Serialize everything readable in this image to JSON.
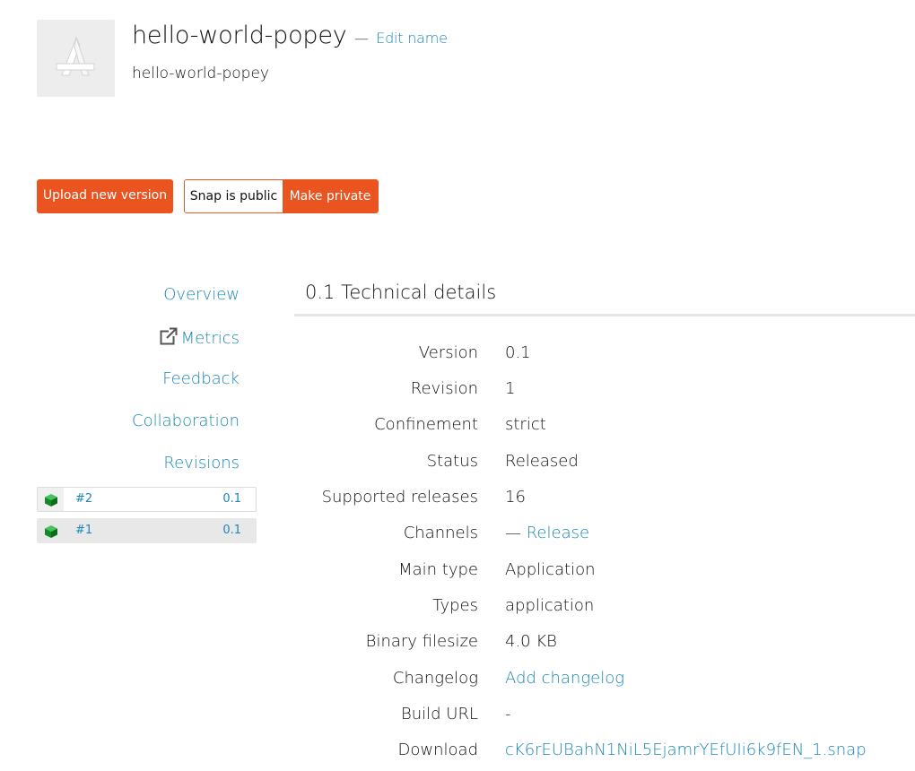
{
  "header": {
    "title": "hello-world-popey",
    "separator": "—",
    "edit_label": "Edit name",
    "subtitle": "hello-world-popey"
  },
  "actions": {
    "upload_label": "Upload new version",
    "public_label": "Snap is public",
    "private_label": "Make private"
  },
  "nav": {
    "overview": "Overview",
    "metrics": "Metrics",
    "feedback": "Feedback",
    "collaboration": "Collaboration",
    "revisions": "Revisions"
  },
  "revisions": [
    {
      "id": "#2",
      "version": "0.1",
      "selected": false
    },
    {
      "id": "#1",
      "version": "0.1",
      "selected": true
    }
  ],
  "details": {
    "title": "0.1 Technical details",
    "rows": {
      "version": {
        "label": "Version",
        "value": "0.1"
      },
      "revision": {
        "label": "Revision",
        "value": "1"
      },
      "confinement": {
        "label": "Confinement",
        "value": "strict"
      },
      "status": {
        "label": "Status",
        "value": "Released"
      },
      "supported_releases": {
        "label": "Supported releases",
        "value": "16"
      },
      "channels": {
        "label": "Channels",
        "prefix": "—",
        "value": "Release"
      },
      "main_type": {
        "label": "Main type",
        "value": "Application"
      },
      "types": {
        "label": "Types",
        "value": "application"
      },
      "binary_filesize": {
        "label": "Binary filesize",
        "value": "4.0 KB"
      },
      "changelog": {
        "label": "Changelog",
        "value": "Add changelog"
      },
      "build_url": {
        "label": "Build URL",
        "value": "-"
      },
      "download": {
        "label": "Download",
        "value": "cK6rEUBahN1NiL5EjamrYEfUIi6k9fEN_1.snap"
      }
    }
  },
  "colors": {
    "accent": "#e95420",
    "link": "#1a87b4",
    "cube": "#0f8a1f"
  }
}
